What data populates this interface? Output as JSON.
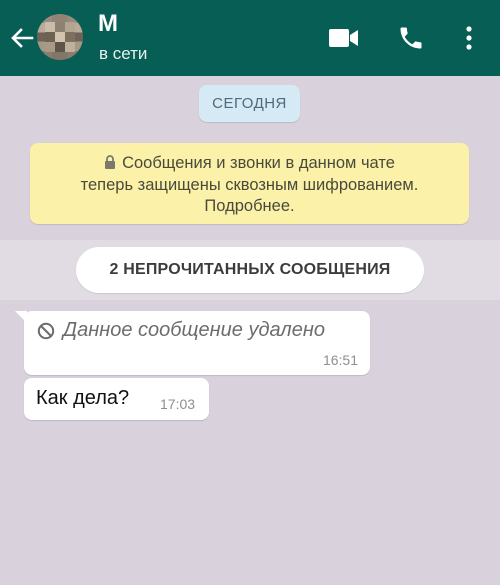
{
  "header": {
    "contact_name": "М",
    "status": "в сети",
    "icons": [
      "back-arrow-icon",
      "avatar",
      "video-call-icon",
      "phone-call-icon",
      "more-vertical-icon"
    ],
    "bg_color": "#075e54"
  },
  "chat": {
    "date_chip": "СЕГОДНЯ",
    "encryption_notice": {
      "line1": "Сообщения и звонки в данном чате",
      "line2": "теперь защищены сквозным шифрованием.",
      "line3": "Подробнее.",
      "icon": "lock-icon"
    },
    "unread_banner": "2 НЕПРОЧИТАННЫХ СООБЩЕНИЯ",
    "messages": [
      {
        "text": "Данное сообщение удалено",
        "time": "16:51",
        "deleted": true,
        "icon": "deleted-icon"
      },
      {
        "text": "Как дела?",
        "time": "17:03",
        "deleted": false
      }
    ]
  }
}
